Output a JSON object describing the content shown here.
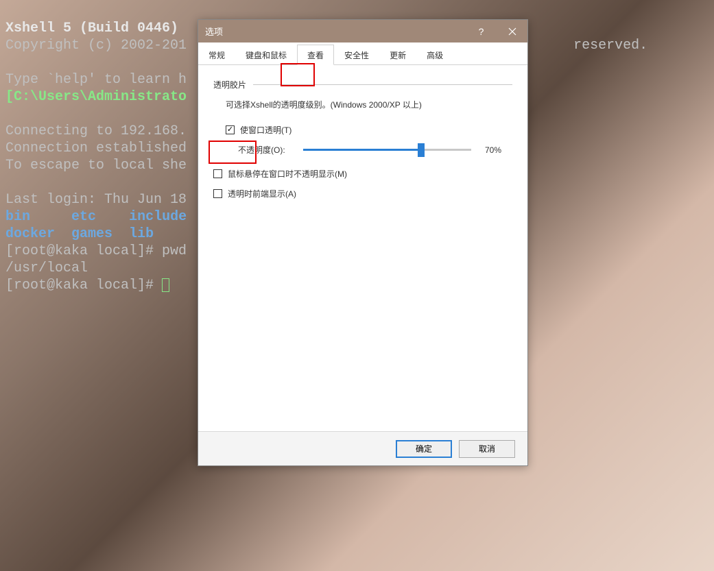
{
  "terminal": {
    "l1": "Xshell 5 (Build 0446)",
    "l2a": "Copyright (c) 2002-201",
    "l2b": " reserved.",
    "l3": "",
    "l4": "Type `help' to learn h",
    "l5": "[C:\\Users\\Administrato",
    "l6": "",
    "l7": "Connecting to 192.168.",
    "l8": "Connection established",
    "l9": "To escape to local she",
    "l10": "",
    "l11": "Last login: Thu Jun 18",
    "dirs1": {
      "a": "bin",
      "b": "etc",
      "c": "include"
    },
    "dirs2": {
      "a": "docker",
      "b": "games",
      "c": "lib"
    },
    "p1a": "[root@kaka local]# ",
    "p1b": "pwd",
    "p2": "/usr/local",
    "p3": "[root@kaka local]# "
  },
  "dialog": {
    "title": "选项",
    "tabs": {
      "t1": "常规",
      "t2": "键盘和鼠标",
      "t3": "查看",
      "t4": "安全性",
      "t5": "更新",
      "t6": "高级"
    },
    "section": {
      "title": "透明胶片",
      "desc": "可选择Xshell的透明度级别。(Windows 2000/XP 以上)"
    },
    "chk1": "使窗口透明(T)",
    "opacity_label": "不透明度(O):",
    "opacity_value": "70%",
    "chk2": "鼠标悬停在窗口时不透明显示(M)",
    "chk3": "透明时前端显示(A)",
    "buttons": {
      "ok": "确定",
      "cancel": "取消"
    }
  }
}
